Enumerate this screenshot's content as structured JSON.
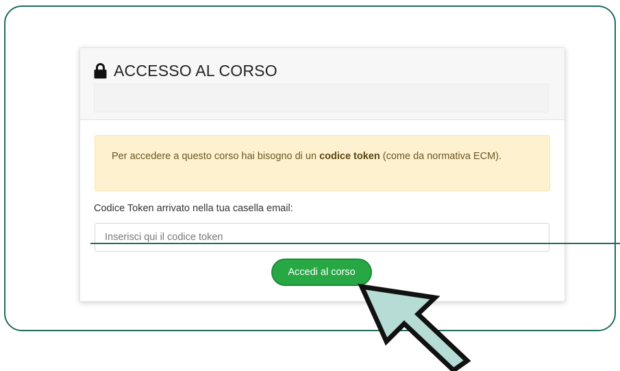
{
  "card": {
    "title": "ACCESSO AL CORSO",
    "lock_icon": "lock-icon"
  },
  "alert": {
    "text_before": "Per accedere a questo corso hai bisogno di un ",
    "text_bold": "codice token",
    "text_after": " (come da normativa ECM)."
  },
  "form": {
    "label": "Codice Token arrivato nella tua casella email:",
    "input_value": "",
    "input_placeholder": "Inserisci qui il codice token",
    "submit_label": "Accedi al corso"
  },
  "annotation": {
    "cursor_icon": "pointer-arrow-icon",
    "frame_color": "#1f6b5a",
    "cursor_fill": "#b6dcd5"
  },
  "colors": {
    "button_green": "#28a745",
    "alert_background": "#fdf1cf"
  }
}
